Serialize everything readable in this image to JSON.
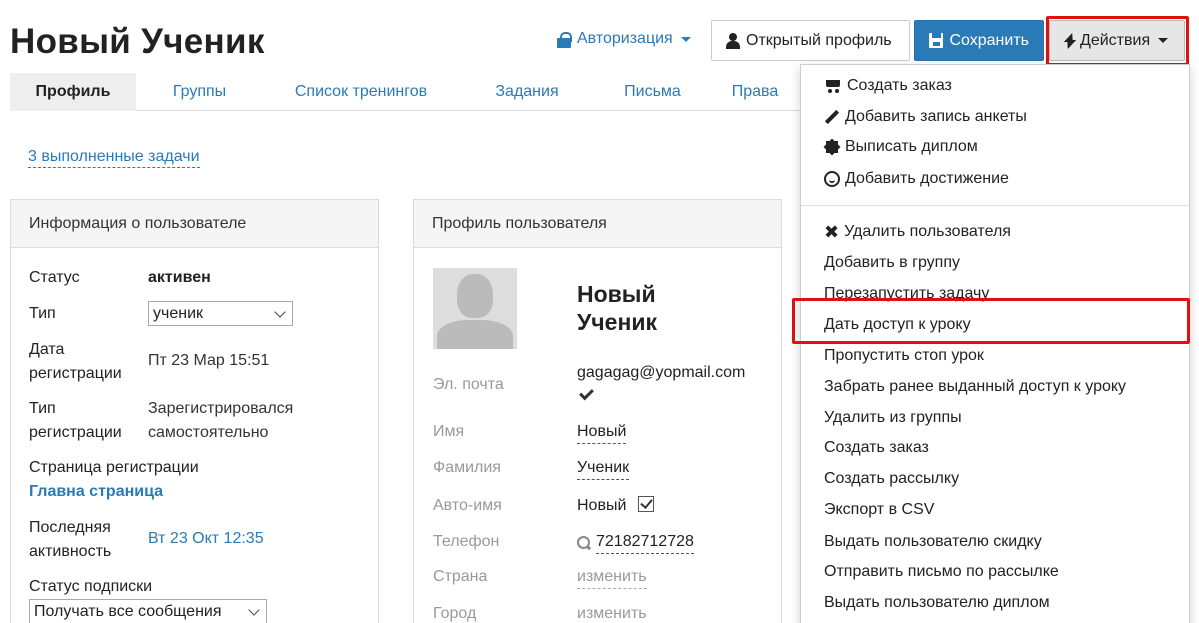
{
  "header": {
    "title": "Новый Ученик",
    "auth_label": "Авторизация",
    "open_profile_label": "Открытый профиль",
    "save_label": "Сохранить",
    "actions_label": "Действия"
  },
  "tabs": [
    {
      "label": "Профиль",
      "active": true
    },
    {
      "label": "Группы"
    },
    {
      "label": "Список тренингов"
    },
    {
      "label": "Задания"
    },
    {
      "label": "Письма"
    },
    {
      "label": "Права"
    }
  ],
  "tasks_link": "3 выполненные задачи",
  "user_info": {
    "title": "Информация о пользователе",
    "status_label": "Статус",
    "status_value": "активен",
    "type_label": "Тип",
    "type_value": "ученик",
    "reg_date_label_1": "Дата",
    "reg_date_label_2": "регистрации",
    "reg_date_value": "Пт 23 Мар 15:51",
    "reg_type_label_1": "Тип",
    "reg_type_label_2": "регистрации",
    "reg_type_value_1": "Зарегистрировался",
    "reg_type_value_2": "самостоятельно",
    "reg_page_label": "Страница регистрации",
    "reg_page_value": "Главна страница",
    "last_activity_label_1": "Последняя",
    "last_activity_label_2": "активность",
    "last_activity_value": "Вт 23 Окт 12:35",
    "subscription_label": "Статус подписки",
    "subscription_value": "Получать все сообщения"
  },
  "user_profile": {
    "title": "Профиль пользователя",
    "name_line1": "Новый",
    "name_line2": "Ученик",
    "email_label": "Эл. почта",
    "email_value": "gagagag@yopmail.com",
    "first_name_label": "Имя",
    "first_name_value": "Новый",
    "last_name_label": "Фамилия",
    "last_name_value": "Ученик",
    "auto_name_label": "Авто-имя",
    "auto_name_value": "Новый",
    "phone_label": "Телефон",
    "phone_value": "72182712728",
    "country_label": "Страна",
    "country_value": "изменить",
    "city_label": "Город",
    "city_value": "изменить"
  },
  "actions_menu": {
    "group1": [
      {
        "label": "Создать заказ",
        "icon": "cart-icon"
      },
      {
        "label": "Добавить запись анкеты",
        "icon": "pencil-icon"
      },
      {
        "label": "Выписать диплом",
        "icon": "certificate-icon"
      },
      {
        "label": "Добавить достижение",
        "icon": "smile-icon"
      }
    ],
    "group2": [
      {
        "label": "Удалить пользователя",
        "icon": "close-icon"
      },
      {
        "label": "Добавить в группу"
      },
      {
        "label": "Перезапустить задачу"
      },
      {
        "label": "Дать доступ к уроку",
        "highlighted": true
      },
      {
        "label": "Пропустить стоп урок"
      },
      {
        "label": "Забрать ранее выданный доступ к уроку"
      },
      {
        "label": "Удалить из группы"
      },
      {
        "label": "Создать заказ"
      },
      {
        "label": "Создать рассылку"
      },
      {
        "label": "Экспорт в CSV"
      },
      {
        "label": "Выдать пользователю скидку"
      },
      {
        "label": "Отправить письмо по рассылке"
      },
      {
        "label": "Выдать пользователю диплом"
      }
    ]
  },
  "colors": {
    "accent": "#2a7ab8",
    "highlight": "#e01010"
  }
}
